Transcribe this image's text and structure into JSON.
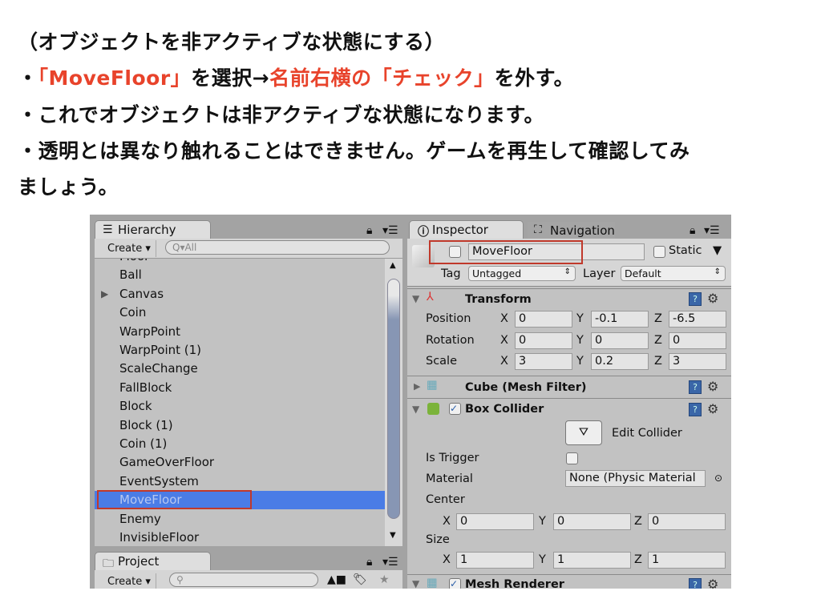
{
  "slide": {
    "lines": [
      {
        "parts": [
          "（オブジェクトを非アクティブな状態にする）"
        ]
      },
      {
        "parts": [
          "・",
          "「MoveFloor」",
          "を選択→",
          "名前右横の「チェック」",
          "を外す。"
        ]
      },
      {
        "parts": [
          "・これでオブジェクトは非アクティブな状態になります。"
        ]
      },
      {
        "parts": [
          "・透明とは異なり触れることはできません。ゲームを再生して確認してみ"
        ]
      },
      {
        "parts": [
          "ましょう。"
        ]
      }
    ],
    "accent_color": "#e8432b"
  },
  "hierarchy": {
    "tab": "Hierarchy",
    "create": "Create ▾",
    "search_placeholder": "All",
    "items": [
      "Floor",
      "Ball",
      "Canvas",
      "Coin",
      "WarpPoint",
      "WarpPoint (1)",
      "ScaleChange",
      "FallBlock",
      "Block",
      "Block (1)",
      "Coin (1)",
      "GameOverFloor",
      "EventSystem",
      "MoveFloor",
      "Enemy",
      "InvisibleFloor"
    ],
    "selected": "MoveFloor",
    "highlight_color": "#4a7ce6"
  },
  "project": {
    "tab": "Project",
    "create": "Create ▾"
  },
  "inspector": {
    "tab": "Inspector",
    "nav_tab": "Navigation",
    "name": "MoveFloor",
    "active": false,
    "static_label": "Static",
    "tag_label": "Tag",
    "tag": "Untagged",
    "layer_label": "Layer",
    "layer": "Default",
    "transform": {
      "title": "Transform",
      "rows": [
        {
          "label": "Position",
          "x": "0",
          "y": "-0.1",
          "z": "-6.5"
        },
        {
          "label": "Rotation",
          "x": "0",
          "y": "0",
          "z": "0"
        },
        {
          "label": "Scale",
          "x": "3",
          "y": "0.2",
          "z": "3"
        }
      ]
    },
    "mesh_filter": "Cube (Mesh Filter)",
    "box_collider": {
      "title": "Box Collider",
      "edit": "Edit Collider",
      "is_trigger": "Is Trigger",
      "material_label": "Material",
      "material": "None (Physic Material",
      "center_label": "Center",
      "center": {
        "x": "0",
        "y": "0",
        "z": "0"
      },
      "size_label": "Size",
      "size": {
        "x": "1",
        "y": "1",
        "z": "1"
      }
    },
    "mesh_renderer": "Mesh Renderer",
    "axis": {
      "x": "X",
      "y": "Y",
      "z": "Z"
    }
  }
}
